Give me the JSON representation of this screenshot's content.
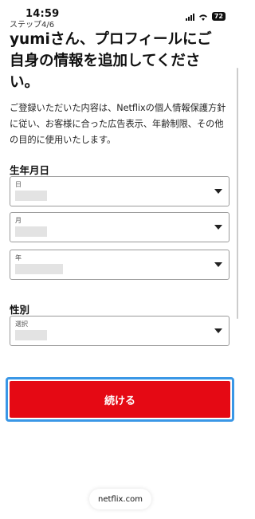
{
  "status_bar": {
    "time": "14:59",
    "battery": "72"
  },
  "step": "ステップ4/6",
  "title": "yumiさん、プロフィールにご自身の情報を追加してください。",
  "description": "ご登録いただいた内容は、Netflixの個人情報保護方針に従い、お客様に合った広告表示、年齢制限、その他の目的に使用いたします。",
  "dob": {
    "label": "生年月日",
    "day_caption": "日",
    "month_caption": "月",
    "year_caption": "年"
  },
  "gender": {
    "label": "性別",
    "caption": "選択"
  },
  "continue_label": "続ける",
  "url": "netflix.com",
  "colors": {
    "accent": "#e50914",
    "focus": "#3a97e6"
  }
}
